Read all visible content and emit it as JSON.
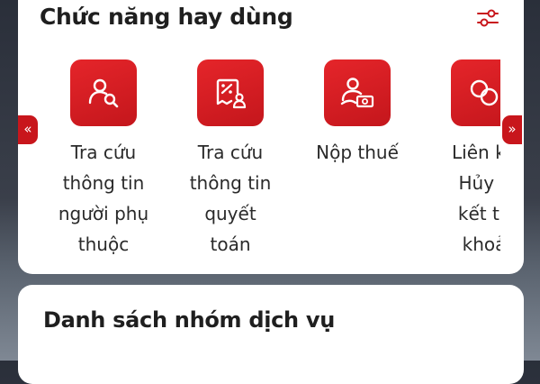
{
  "frequent_functions": {
    "title": "Chức năng hay dùng",
    "filter_icon": "sliders-icon",
    "accent_color": "#d71920",
    "prev_arrow": "«",
    "next_arrow": "»",
    "items": [
      {
        "icon": "person-search-icon",
        "lines": [
          "Tra cứu",
          "thông tin",
          "người phụ",
          "thuộc"
        ]
      },
      {
        "icon": "settlement-receipt-icon",
        "lines": [
          "Tra cứu",
          "thông tin",
          "quyết",
          "toán"
        ]
      },
      {
        "icon": "tax-payment-icon",
        "lines": [
          "Nộp thuế"
        ]
      },
      {
        "icon": "link-unlink-icon",
        "lines": [
          "Liên kế",
          "Hủy li",
          "kết tà",
          "khoả"
        ]
      }
    ]
  },
  "service_groups": {
    "title": "Danh sách nhóm dịch vụ"
  }
}
